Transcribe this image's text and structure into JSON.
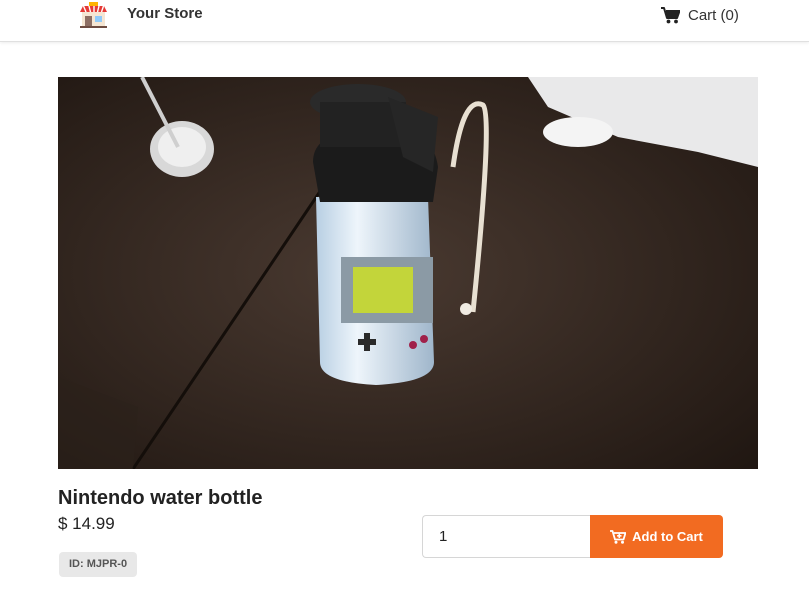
{
  "header": {
    "store_name": "Your Store",
    "cart_label": "Cart",
    "cart_count_text": "(0)",
    "logo_icon": "storefront-icon",
    "cart_icon": "shopping-cart-icon"
  },
  "product": {
    "title": "Nintendo water bottle",
    "price": "$ 14.99",
    "id_badge": "ID: MJPR-0",
    "image_subject": "photo-water-bottle"
  },
  "purchase": {
    "quantity_value": "1",
    "add_to_cart_label": "Add to Cart",
    "add_icon": "cart-plus-icon"
  },
  "colors": {
    "accent": "#f26b21",
    "badge_bg": "#e8e8e8",
    "text": "#222222"
  }
}
